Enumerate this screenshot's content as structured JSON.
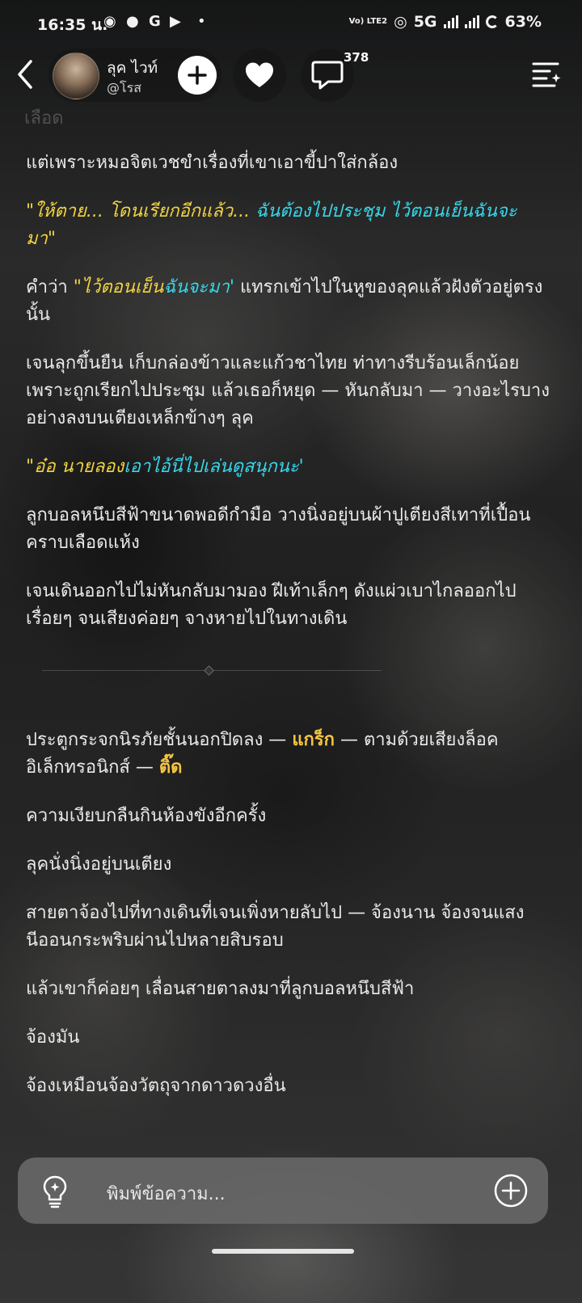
{
  "status": {
    "time": "16:35 น.",
    "network": "5G",
    "volte": "Vo) LTE2",
    "battery": "63%"
  },
  "header": {
    "name": "ลุค ไวท์",
    "handle": "@โรส",
    "comment_count": "378"
  },
  "content": {
    "cut_line": "เลือด",
    "p1": "แต่เพราะหมอจิตเวชขำเรื่องที่เขาเอาขี้ปาใส่กล้อง",
    "q1_part1": "\"ให้ตาย... โดนเรียกอีกแล้ว... ",
    "q1_part2": "ฉันต้องไปประชุม ไว้ตอนเย็นฉันจะ",
    "q1_part3": "มา\"",
    "p2_pre": "คำว่า ",
    "p2_quote_a": "\"ไว้ตอนเย็น",
    "p2_quote_b": "ฉันจะมา'",
    "p2_post": " แทรกเข้าไปในหูของลุคแล้วฝังตัวอยู่ตรงนั้น",
    "p3": "เจนลุกขึ้นยืน เก็บกล่องข้าวและแก้วชาไทย ท่าทางรีบร้อนเล็กน้อยเพราะถูกเรียกไปประชุม แล้วเธอก็หยุด — หันกลับมา — วางอะไรบางอย่างลงบนเตียงเหล็กข้างๆ ลุค",
    "q2_a": "\"อ๋อ นายลอง",
    "q2_b": "เอาไอ้นี่ไปเล่นดูสนุกนะ'",
    "p4": "ลูกบอลหนึบสีฟ้าขนาดพอดีกำมือ วางนิ่งอยู่บนผ้าปูเตียงสีเทาที่เปื้อนคราบเลือดแห้ง",
    "p5": "เจนเดินออกไปไม่หันกลับมามอง ฝีเท้าเล็กๆ ดังแผ่วเบาไกลออกไปเรื่อยๆ จนเสียงค่อยๆ จางหายไปในทางเดิน",
    "p6_a": "ประตูกระจกนิรภัยชั้นนอกปิดลง — ",
    "p6_sfx1": "แกร็ก",
    "p6_b": " — ตามด้วยเสียงล็อคอิเล็กทรอนิกส์ — ",
    "p6_sfx2": "ติ๊ด",
    "p7": "ความเงียบกลืนกินห้องขังอีกครั้ง",
    "p8": "ลุคนั่งนิ่งอยู่บนเตียง",
    "p9": "สายตาจ้องไปที่ทางเดินที่เจนเพิ่งหายลับไป — จ้องนาน จ้องจนแสงนีออนกระพริบผ่านไปหลายสิบรอบ",
    "p10": "แล้วเขาก็ค่อยๆ เลื่อนสายตาลงมาที่ลูกบอลหนึบสีฟ้า",
    "p11": "จ้องมัน",
    "p12": "จ้องเหมือนจ้องวัตถุจากดาวดวงอื่น"
  },
  "composer": {
    "placeholder": "พิมพ์ข้อความ..."
  },
  "icons": {
    "back": "chevron-left-icon",
    "follow": "plus-icon",
    "like": "heart-icon",
    "comments": "speech-bubble-icon",
    "menu": "menu-sparkle-icon",
    "hint": "lightbulb-icon",
    "add": "plus-circle-icon"
  },
  "colors": {
    "dialogue_yellow": "#f2d442",
    "dialogue_cyan": "#37d7ea",
    "sfx": "#f5c542"
  }
}
